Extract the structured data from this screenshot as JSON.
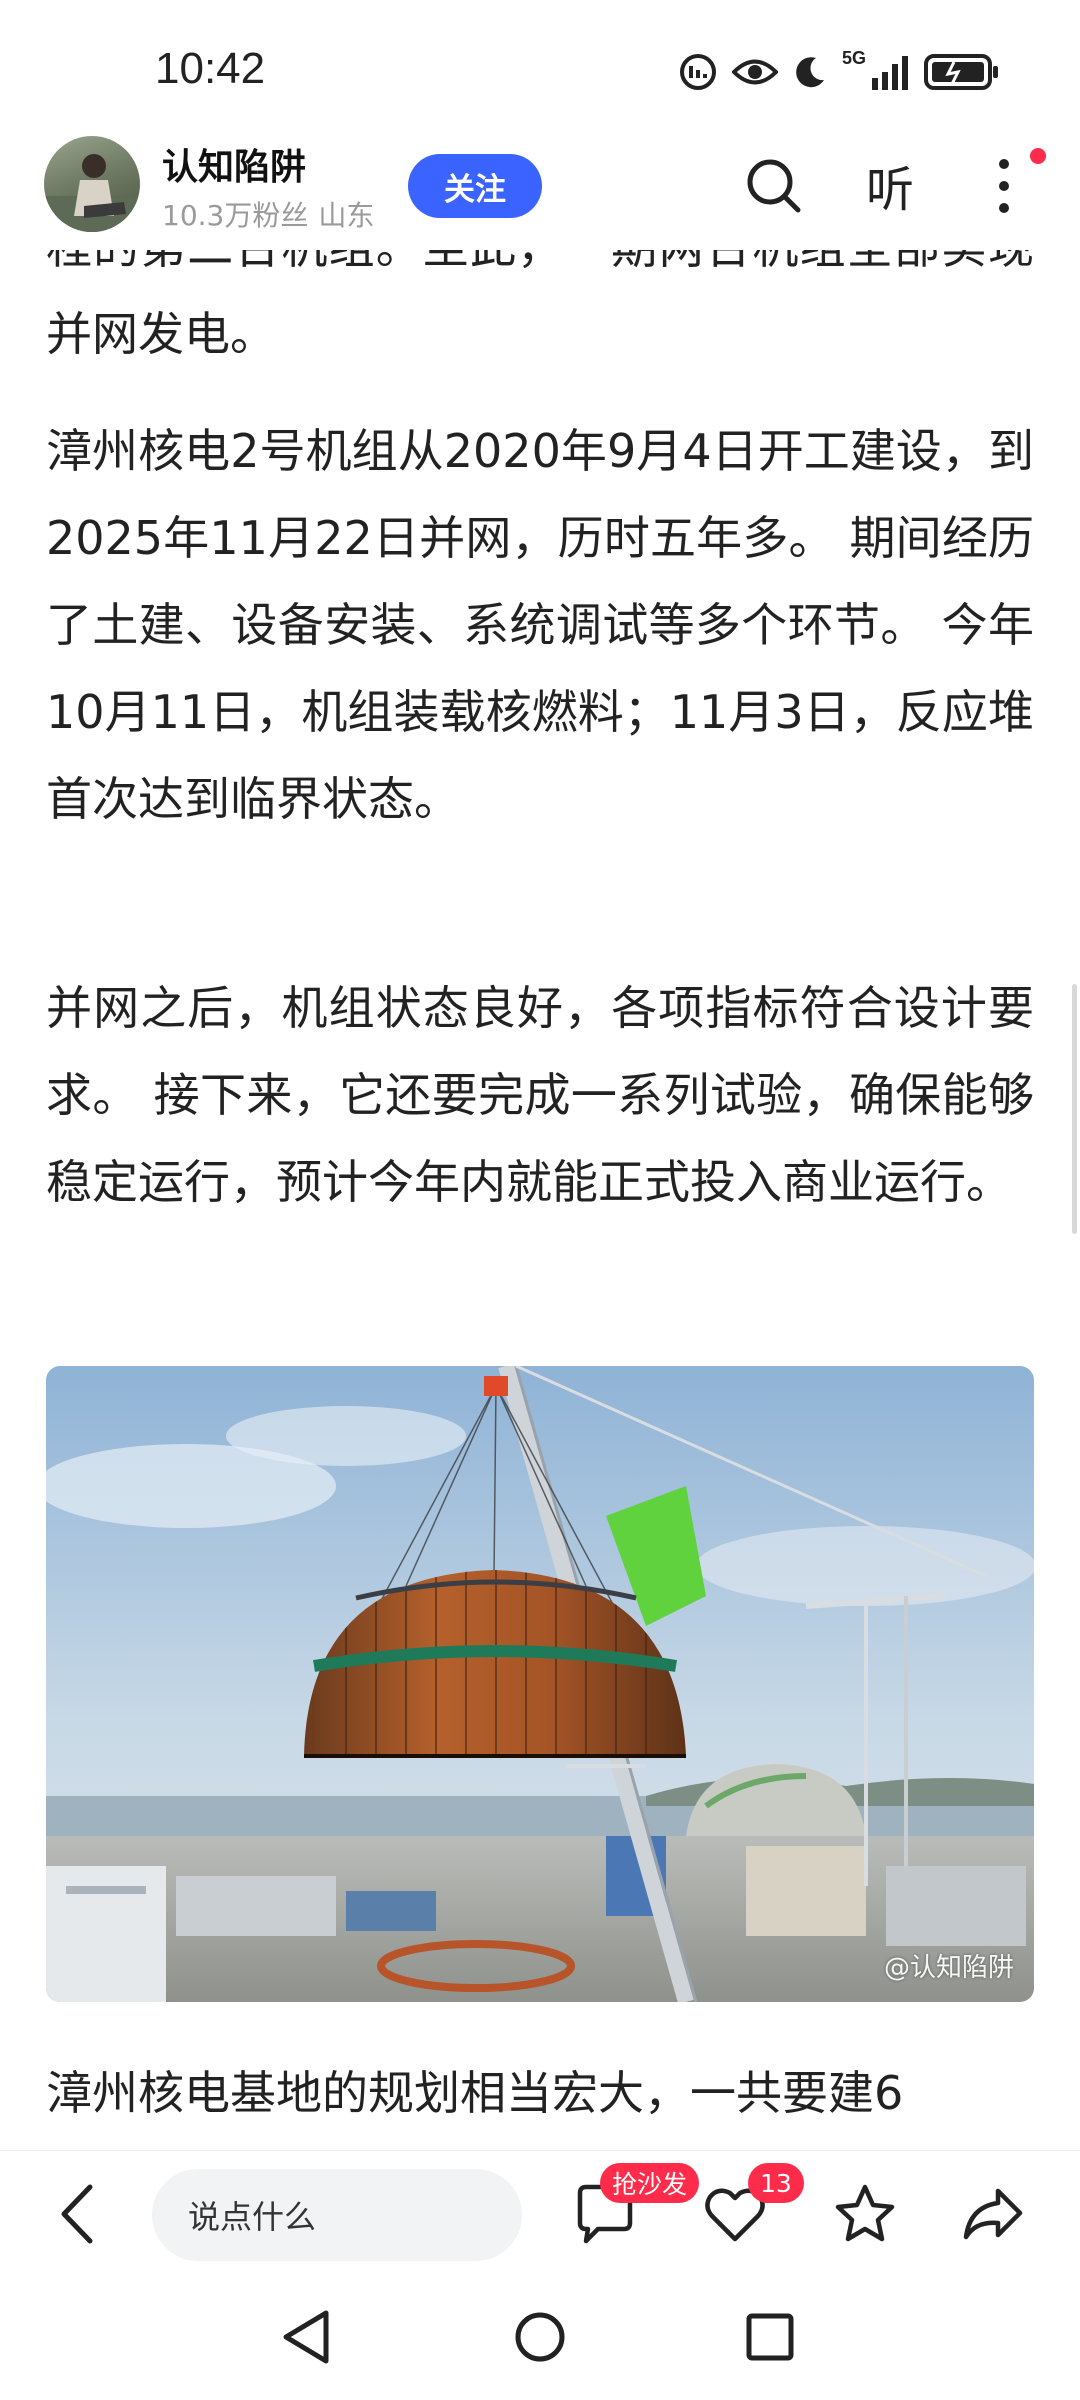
{
  "status_bar": {
    "time": "10:42",
    "network": "5G"
  },
  "author": {
    "name": "认知陷阱",
    "followers": "10.3万粉丝",
    "location": "山东",
    "follow_label": "关注"
  },
  "header_actions": {
    "listen_label": "听"
  },
  "article": {
    "paragraphs": [
      "程的第二台机组。至此，一期两台机组全部实现并网发电。",
      "漳州核电2号机组从2020年9月4日开工建设，到2025年11月22日并网，历时五年多。 期间经历了土建、设备安装、系统调试等多个环节。 今年10月11日，机组装载核燃料；11月3日，反应堆首次达到临界状态。",
      "并网之后，机组状态良好，各项指标符合设计要求。 接下来，它还要完成一系列试验，确保能够稳定运行，预计今年内就能正式投入商业运行。",
      "漳州核电基地的规划相当宏大，一共要建6"
    ],
    "image_watermark": "@认知陷阱"
  },
  "bottom_bar": {
    "comment_placeholder": "说点什么",
    "comment_badge": "抢沙发",
    "like_count": "13"
  },
  "colors": {
    "accent_blue": "#3a63ff",
    "badge_red": "#ff2b4a",
    "text_primary": "#222222",
    "text_secondary": "#9a9a9a"
  },
  "icons": [
    "wifi-calling-icon",
    "eye-icon",
    "moon-icon",
    "signal-icon",
    "battery-icon",
    "search-icon",
    "more-icon",
    "back-icon",
    "comment-icon",
    "heart-icon",
    "star-icon",
    "share-icon",
    "nav-back-icon",
    "nav-home-icon",
    "nav-recent-icon"
  ]
}
